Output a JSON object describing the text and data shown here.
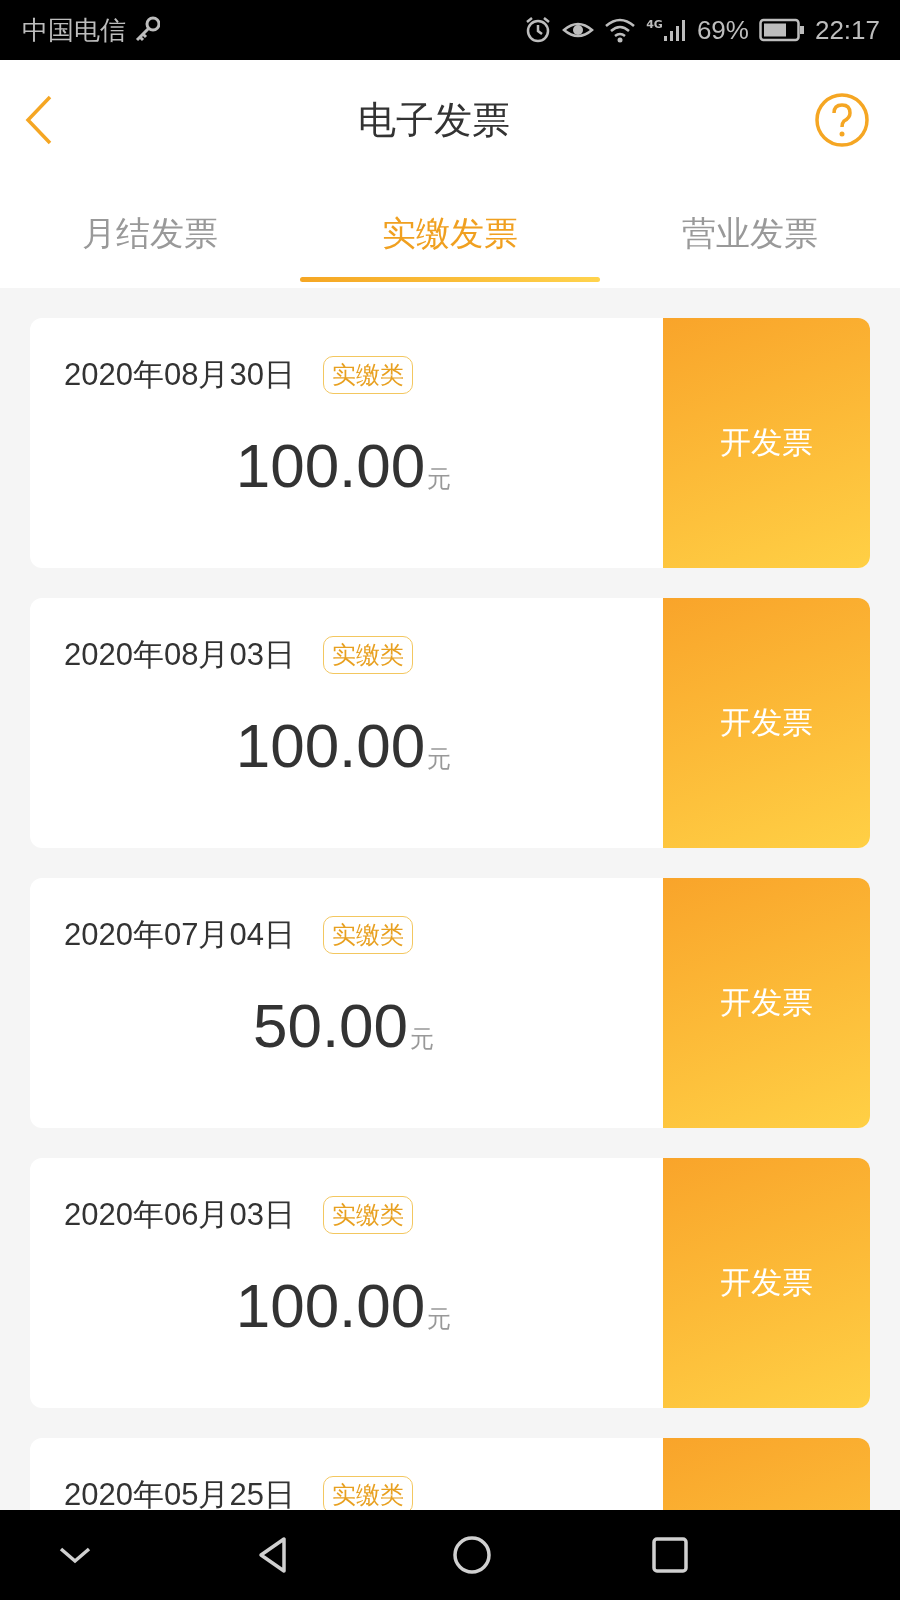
{
  "status_bar": {
    "carrier": "中国电信",
    "network": "4G",
    "battery": "69%",
    "time": "22:17"
  },
  "header": {
    "title": "电子发票"
  },
  "tabs": [
    {
      "label": "月结发票",
      "selected": false
    },
    {
      "label": "实缴发票",
      "selected": true
    },
    {
      "label": "营业发票",
      "selected": false
    }
  ],
  "invoices": [
    {
      "date": "2020年08月30日",
      "tag": "实缴类",
      "amount": "100.00",
      "unit": "元",
      "button": "开发票"
    },
    {
      "date": "2020年08月03日",
      "tag": "实缴类",
      "amount": "100.00",
      "unit": "元",
      "button": "开发票"
    },
    {
      "date": "2020年07月04日",
      "tag": "实缴类",
      "amount": "50.00",
      "unit": "元",
      "button": "开发票"
    },
    {
      "date": "2020年06月03日",
      "tag": "实缴类",
      "amount": "100.00",
      "unit": "元",
      "button": "开发票"
    },
    {
      "date": "2020年05月25日",
      "tag": "实缴类"
    }
  ]
}
